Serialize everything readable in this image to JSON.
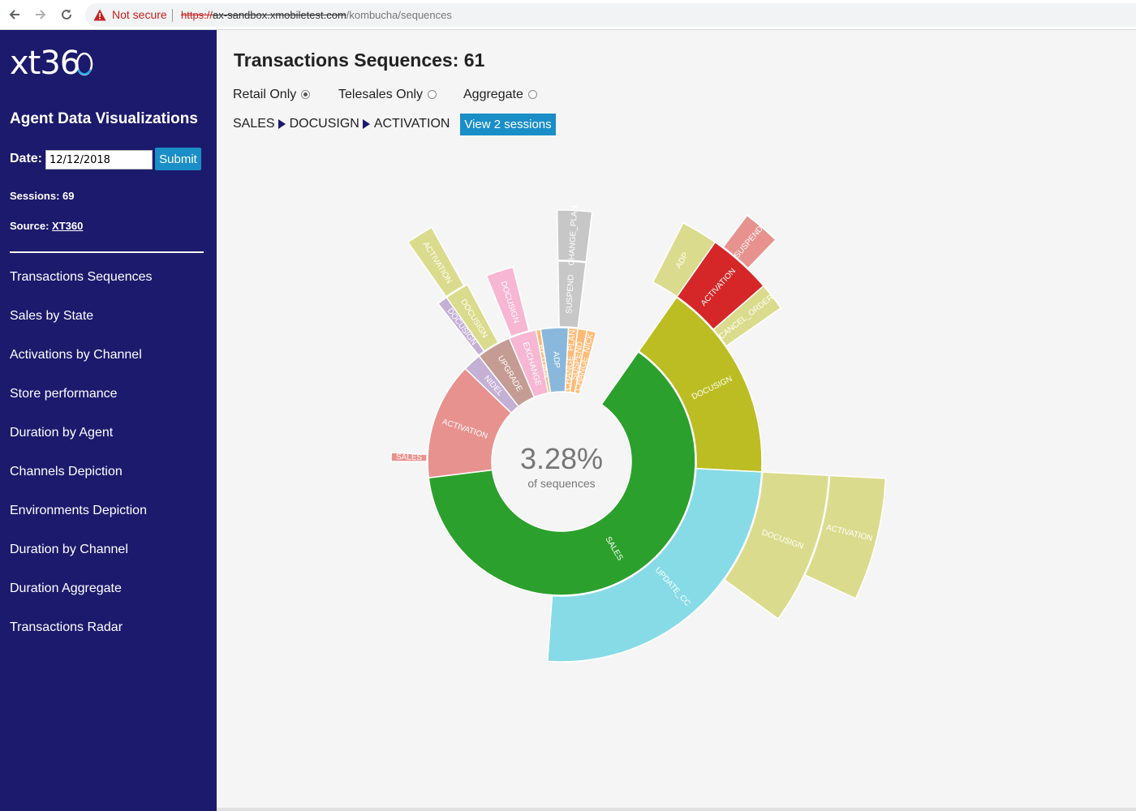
{
  "browser": {
    "security": "Not secure",
    "url_scheme": "https://",
    "url_host": "ax-sandbox.xmobiletest.com",
    "url_path": "/kombucha/sequences"
  },
  "sidebar": {
    "logo": "xt360",
    "app_title": "Agent Data Visualizations",
    "date_label": "Date:",
    "date_value": "12/12/2018",
    "submit_label": "Submit",
    "sessions_text": "Sessions: 69",
    "source_label": "Source:",
    "source_link": "XT360",
    "nav": [
      "Transactions Sequences",
      "Sales by State",
      "Activations by Channel",
      "Store performance",
      "Duration by Agent",
      "Channels Depiction",
      "Environments Depiction",
      "Duration by Channel",
      "Duration Aggregate",
      "Transactions Radar"
    ]
  },
  "main": {
    "title": "Transactions Sequences: 61",
    "filters": [
      {
        "label": "Retail Only",
        "checked": true
      },
      {
        "label": "Telesales Only",
        "checked": false
      },
      {
        "label": "Aggregate",
        "checked": false
      }
    ],
    "breadcrumb": [
      "SALES",
      "DOCUSIGN",
      "ACTIVATION"
    ],
    "view_button": "View 2 sessions",
    "center_percent": "3.28%",
    "center_caption": "of sequences"
  },
  "colors": {
    "sidebar_bg": "#1b1a6d",
    "button_blue": "#1a8ec7",
    "sales": "#2ca02c",
    "update_cc": "#87dbe6",
    "docusign": "#bcbd22",
    "docusign_light": "#dbdb8d",
    "activation": "#e8928f",
    "activation_highlight": "#d62728",
    "upgrade": "#c49c94",
    "exchange": "#f7b6d2",
    "adp": "#8ab8dc",
    "suspend_grey": "#c7c7c7",
    "nidel": "#c5b0d5",
    "return_orange": "#ffbb78"
  },
  "chart_data": {
    "type": "sunburst",
    "center_text": "3.28%",
    "center_subtext": "of sequences",
    "tree": {
      "name": "root",
      "children": [
        {
          "name": "SALES",
          "children": [
            {
              "name": "UPDATE_CC",
              "children": [
                {
                  "name": "DOCUSIGN",
                  "children": [
                    {
                      "name": "ACTIVATION"
                    }
                  ]
                }
              ]
            },
            {
              "name": "DOCUSIGN",
              "children": [
                {
                  "name": "ADP"
                },
                {
                  "name": "ACTIVATION",
                  "children": [
                    {
                      "name": "SUSPEND"
                    }
                  ]
                },
                {
                  "name": "CANCEL_ORDER"
                }
              ]
            },
            {
              "name": "ADP"
            },
            {
              "name": "CHANGE_PLAN"
            },
            {
              "name": "SUSPEND"
            },
            {
              "name": "CHANGE_NICK"
            }
          ]
        },
        {
          "name": "ACTIVATION",
          "children": [
            {
              "name": "SALES"
            }
          ]
        },
        {
          "name": "NIDEL",
          "children": [
            {
              "name": "DOCUSIGN"
            }
          ]
        },
        {
          "name": "UPGRADE",
          "children": [
            {
              "name": "DOCUSIGN",
              "children": [
                {
                  "name": "ACTIVATION"
                }
              ]
            }
          ]
        },
        {
          "name": "EXCHANGE",
          "children": [
            {
              "name": "DOCUSIGN"
            }
          ]
        },
        {
          "name": "RETURN"
        },
        {
          "name": "ADP",
          "children": [
            {
              "name": "SUSPEND",
              "children": [
                {
                  "name": "CHANGE_PLAN"
                }
              ]
            }
          ]
        },
        {
          "name": "CHANGE_PLAN"
        },
        {
          "name": "SUSPEND"
        },
        {
          "name": "CHANGE_NICK"
        }
      ]
    }
  }
}
